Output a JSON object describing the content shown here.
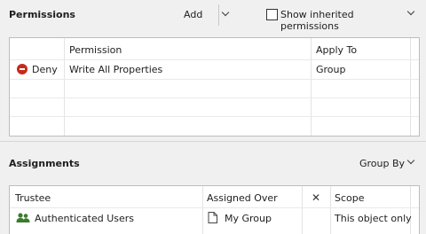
{
  "permissions": {
    "title": "Permissions",
    "add_label": "Add",
    "show_inherited_label": "Show inherited permissions",
    "columns": [
      "Permission",
      "Apply To"
    ],
    "rows": [
      {
        "type": "Deny",
        "permission": "Write All Properties",
        "apply_to": "Group"
      }
    ]
  },
  "assignments": {
    "title": "Assignments",
    "group_by_label": "Group By",
    "columns": [
      "Trustee",
      "Assigned Over",
      "Scope"
    ],
    "remove_symbol": "✕",
    "rows": [
      {
        "trustee": "Authenticated Users",
        "assigned_over": "My Group",
        "scope": "This object only"
      }
    ]
  },
  "colors": {
    "deny": "#c42b1c",
    "users_icon": "#3c7a2e",
    "background": "#f0f0f0"
  }
}
